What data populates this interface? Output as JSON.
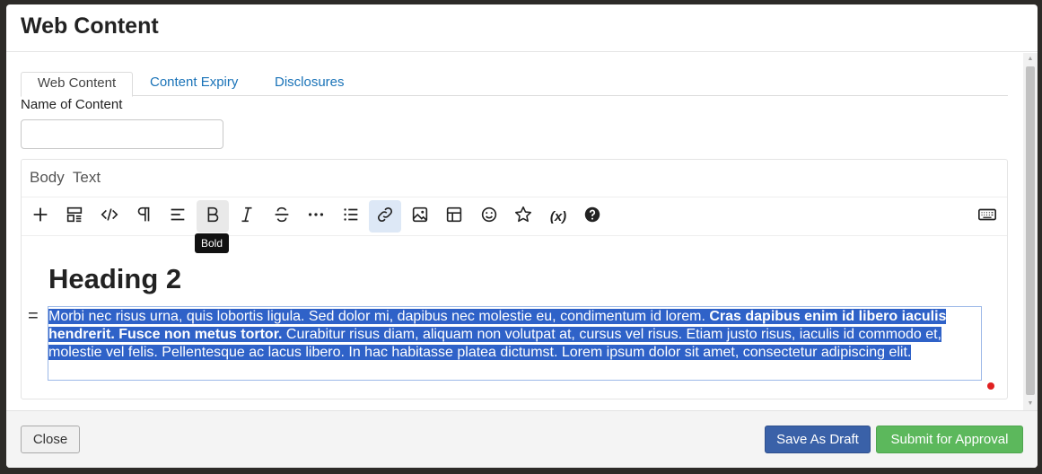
{
  "modal": {
    "title": "Web Content"
  },
  "tabs": [
    {
      "label": "Web Content",
      "active": true
    },
    {
      "label": "Content Expiry",
      "active": false
    },
    {
      "label": "Disclosures",
      "active": false
    }
  ],
  "form": {
    "name_label": "Name of Content",
    "name_value": "",
    "body_label": "Body  Text"
  },
  "toolbar": {
    "items": [
      {
        "icon": "plus-icon"
      },
      {
        "icon": "fragments-icon"
      },
      {
        "icon": "code-icon"
      },
      {
        "icon": "paragraph-icon"
      },
      {
        "icon": "align-icon"
      },
      {
        "icon": "bold-icon"
      },
      {
        "icon": "italic-icon"
      },
      {
        "icon": "strikethrough-icon"
      },
      {
        "icon": "more-icon"
      },
      {
        "icon": "list-icon"
      },
      {
        "icon": "link-icon"
      },
      {
        "icon": "image-icon"
      },
      {
        "icon": "table-icon"
      },
      {
        "icon": "emoji-icon"
      },
      {
        "icon": "star-icon"
      },
      {
        "icon": "variable-icon",
        "text": "(x)"
      },
      {
        "icon": "help-icon"
      },
      {
        "icon": "keyboard-icon"
      }
    ],
    "tooltip": "Bold"
  },
  "content": {
    "heading": "Heading 2",
    "drag_handle": "=",
    "para_part1": "Morbi nec risus urna, quis lobortis ligula. Sed dolor mi, dapibus nec molestie eu, condimentum id lorem. ",
    "para_bold": "Cras dapibus enim id libero iaculis hendrerit. Fusce non metus tortor.",
    "para_part2": " Curabitur risus diam, aliquam non volutpat at, cursus vel risus. Etiam justo risus, iaculis id commodo et, molestie vel felis. Pellentesque ac lacus libero. In hac habitasse platea dictumst. Lorem ipsum dolor sit amet, consectetur adipiscing elit."
  },
  "footer": {
    "close_label": "Close",
    "draft_label": "Save As Draft",
    "submit_label": "Submit for Approval"
  },
  "colors": {
    "selection": "#2f62c8",
    "link": "#1a73b8",
    "draft_button": "#3a61a8",
    "submit_button": "#5cb85c"
  }
}
